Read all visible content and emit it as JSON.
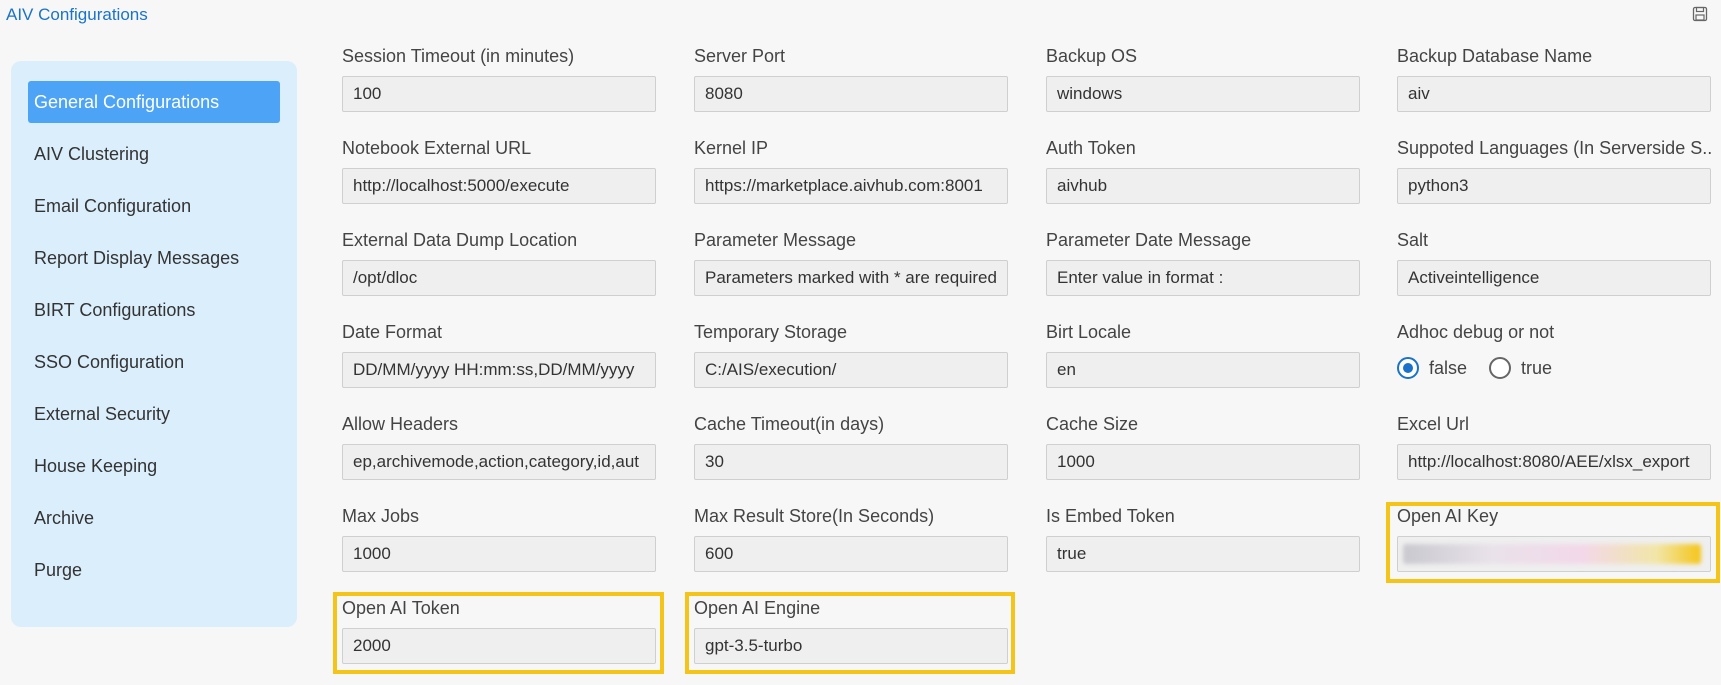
{
  "app": {
    "title": "AIV Configurations"
  },
  "colors": {
    "accent": "#1a73c9",
    "active_item": "#4da3f5",
    "sidebar_bg": "#dbeefc",
    "highlight": "#f4c518"
  },
  "toolbar": {
    "save_icon": "save-icon"
  },
  "sidebar": {
    "items": [
      {
        "label": "General Configurations",
        "active": true
      },
      {
        "label": "AIV Clustering"
      },
      {
        "label": "Email Configuration"
      },
      {
        "label": "Report Display Messages"
      },
      {
        "label": "BIRT Configurations"
      },
      {
        "label": "SSO Configuration"
      },
      {
        "label": "External Security"
      },
      {
        "label": "House Keeping"
      },
      {
        "label": "Archive"
      },
      {
        "label": "Purge"
      }
    ]
  },
  "fields": {
    "session_timeout": {
      "label": "Session Timeout (in minutes)",
      "value": "100"
    },
    "server_port": {
      "label": "Server Port",
      "value": "8080"
    },
    "backup_os": {
      "label": "Backup OS",
      "value": "windows"
    },
    "backup_db_name": {
      "label": "Backup Database Name",
      "value": "aiv"
    },
    "notebook_url": {
      "label": "Notebook External URL",
      "value": "http://localhost:5000/execute"
    },
    "kernel_ip": {
      "label": "Kernel IP",
      "value": "https://marketplace.aivhub.com:8001"
    },
    "auth_token": {
      "label": "Auth Token",
      "value": "aivhub"
    },
    "supported_languages": {
      "label": "Suppoted Languages (In Serverside S...",
      "value": "python3"
    },
    "dump_location": {
      "label": "External Data Dump Location",
      "value": "/opt/dloc"
    },
    "parameter_message": {
      "label": "Parameter Message",
      "value": "Parameters marked with * are required"
    },
    "parameter_date_message": {
      "label": "Parameter Date Message",
      "value": "Enter value in format :"
    },
    "salt": {
      "label": "Salt",
      "value": "Activeintelligence"
    },
    "date_format": {
      "label": "Date Format",
      "value": "DD/MM/yyyy HH:mm:ss,DD/MM/yyyy"
    },
    "temporary_storage": {
      "label": "Temporary Storage",
      "value": "C:/AIS/execution/"
    },
    "birt_locale": {
      "label": "Birt Locale",
      "value": "en"
    },
    "adhoc_debug": {
      "label": "Adhoc debug or not",
      "options": [
        "false",
        "true"
      ],
      "selected": "false"
    },
    "allow_headers": {
      "label": "Allow Headers",
      "value": "ep,archivemode,action,category,id,aut"
    },
    "cache_timeout": {
      "label": "Cache Timeout(in days)",
      "value": "30"
    },
    "cache_size": {
      "label": "Cache Size",
      "value": "1000"
    },
    "excel_url": {
      "label": "Excel Url",
      "value": "http://localhost:8080/AEE/xlsx_export"
    },
    "max_jobs": {
      "label": "Max Jobs",
      "value": "1000"
    },
    "max_result_store": {
      "label": "Max Result Store(In Seconds)",
      "value": "600"
    },
    "is_embed_token": {
      "label": "Is Embed Token",
      "value": "true"
    },
    "open_ai_key": {
      "label": "Open AI Key",
      "value": ""
    },
    "open_ai_token": {
      "label": "Open AI Token",
      "value": "2000"
    },
    "open_ai_engine": {
      "label": "Open AI Engine",
      "value": "gpt-3.5-turbo"
    }
  }
}
